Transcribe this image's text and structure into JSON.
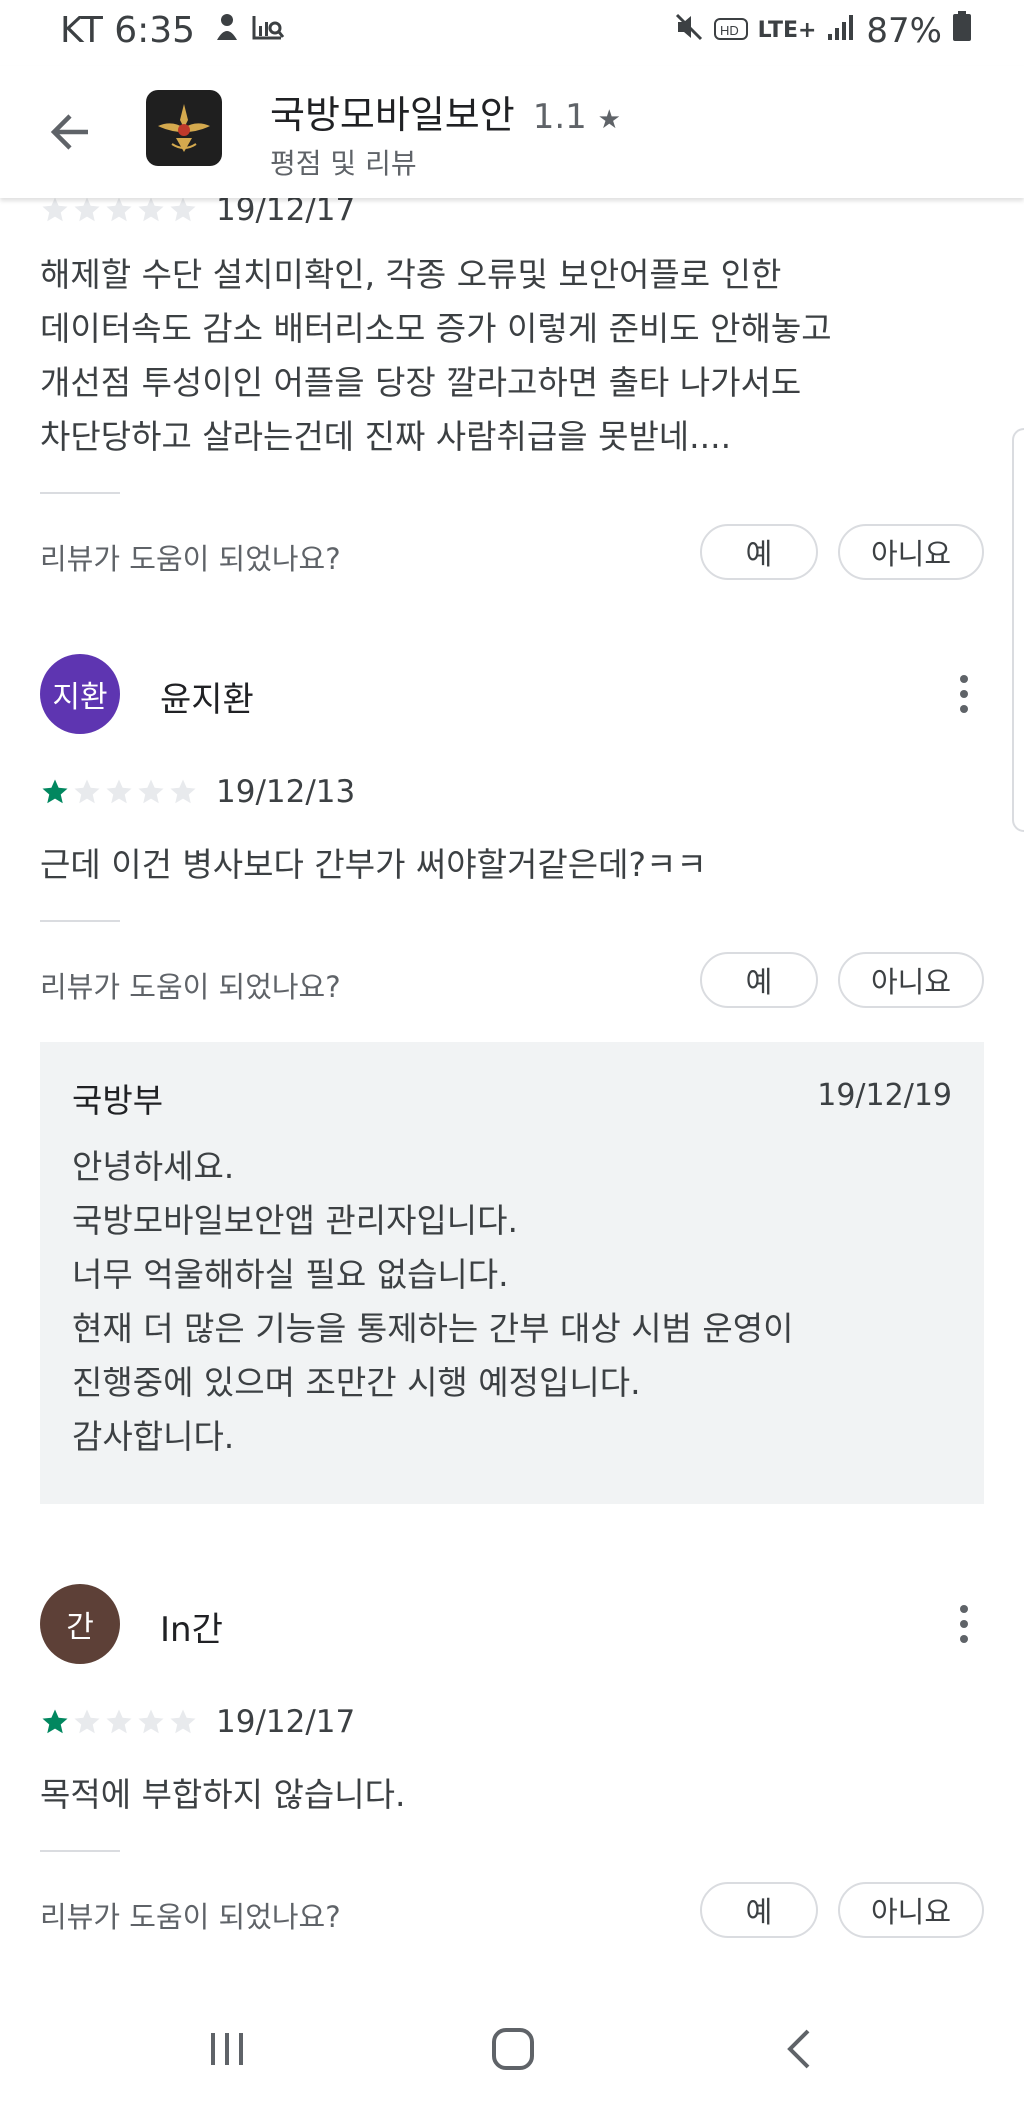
{
  "status_bar": {
    "carrier_time": "KT 6:35",
    "network": "LTE+",
    "battery": "87%"
  },
  "header": {
    "title": "국방모바일보안",
    "rating": "1.1",
    "subtitle": "평점 및 리뷰"
  },
  "helpful": {
    "question": "리뷰가 도움이 되었나요?",
    "yes": "예",
    "no": "아니요"
  },
  "reviews": [
    {
      "date": "19/12/17",
      "rating": 1,
      "text_lines": [
        "해제할 수단 설치미확인, 각종 오류및 보안어플로 인한",
        "데이터속도 감소 배터리소모 증가 이렇게 준비도 안해놓고",
        "개선점 투성이인 어플을 당장 깔라고하면 출타 나가서도",
        "차단당하고 살라는건데 진짜 사람취급을 못받네...."
      ]
    },
    {
      "avatar_text": "지환",
      "avatar_color": "#5e35b1",
      "author": "윤지환",
      "date": "19/12/13",
      "rating": 1,
      "text": "근데 이건 병사보다 간부가 써야할거같은데?ㅋㅋ",
      "reply": {
        "author": "국방부",
        "date": "19/12/19",
        "lines": [
          "안녕하세요.",
          "국방모바일보안앱 관리자입니다.",
          "너무 억울해하실 필요 없습니다.",
          "현재 더 많은 기능을 통제하는 간부 대상 시범 운영이",
          "진행중에 있으며 조만간 시행 예정입니다.",
          "감사합니다."
        ]
      }
    },
    {
      "avatar_text": "간",
      "avatar_color": "#5d4037",
      "author": "In간",
      "date": "19/12/17",
      "rating": 1,
      "text": "목적에 부합하지 않습니다."
    }
  ],
  "colors": {
    "star_filled": "#01875f",
    "star_empty": "#e8eaed",
    "reply_bg": "#f1f3f4"
  },
  "icons": [
    "back-arrow-icon",
    "app-logo-icon",
    "more-vert-icon",
    "recent-apps-icon",
    "home-icon",
    "nav-back-icon",
    "mute-icon",
    "signal-icon",
    "battery-icon"
  ]
}
